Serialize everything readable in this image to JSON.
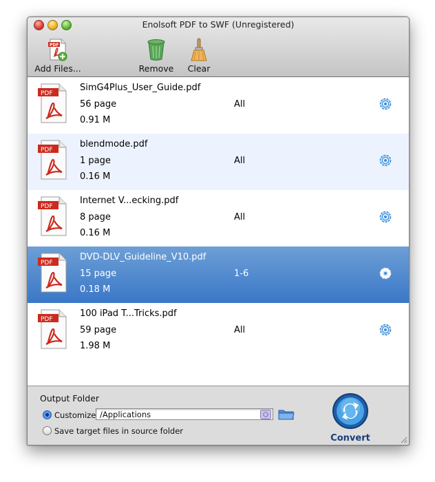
{
  "window": {
    "title": "Enolsoft PDF to SWF (Unregistered)"
  },
  "toolbar": {
    "add_label": "Add Files...",
    "add_icon_text": "PDF",
    "remove_label": "Remove",
    "clear_label": "Clear"
  },
  "files": [
    {
      "name": "SimG4Plus_User_Guide.pdf",
      "pages": "56 page",
      "size": "0.91 M",
      "range": "All",
      "icon_text": "PDF"
    },
    {
      "name": "blendmode.pdf",
      "pages": "1 page",
      "size": "0.16 M",
      "range": "All",
      "icon_text": "PDF"
    },
    {
      "name": "Internet V...ecking.pdf",
      "pages": "8 page",
      "size": "0.16 M",
      "range": "All",
      "icon_text": "PDF"
    },
    {
      "name": "DVD-DLV_Guideline_V10.pdf",
      "pages": "15 page",
      "size": "0.18 M",
      "range": "1-6",
      "icon_text": "PDF",
      "selected": true
    },
    {
      "name": "100 iPad T...Tricks.pdf",
      "pages": "59 page",
      "size": "1.98 M",
      "range": "All",
      "icon_text": "PDF"
    }
  ],
  "output": {
    "label": "Output Folder",
    "customize_label": "Customize",
    "path": "/Applications",
    "source_label": "Save target files in source folder",
    "selected_option": "Customize"
  },
  "convert": {
    "label": "Convert"
  },
  "colors": {
    "selection": "#3a77c7",
    "alt_row": "#edf3fe",
    "pdf_red": "#cc2a1e",
    "gear_blue": "#3b8bd8"
  }
}
